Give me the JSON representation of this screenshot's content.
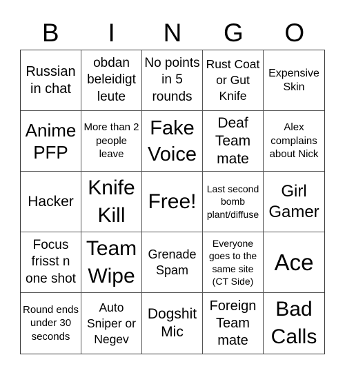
{
  "header": {
    "letters": [
      "B",
      "I",
      "N",
      "G",
      "O"
    ]
  },
  "board": {
    "cells": [
      "Russian in chat",
      "obdan beleidigt leute",
      "No points in 5 rounds",
      "Rust Coat or Gut Knife",
      "Expensive Skin",
      "Anime PFP",
      "More than 2 people leave",
      "Fake Voice",
      "Deaf Team mate",
      "Alex complains about Nick",
      "Hacker",
      "Knife Kill",
      "Free!",
      "Last second bomb plant/diffuse",
      "Girl Gamer",
      "Focus frisst n one shot",
      "Team Wipe",
      "Grenade Spam",
      "Everyone goes to the same site (CT Side)",
      "Ace",
      "Round ends under 30 seconds",
      "Auto Sniper or Negev",
      "Dogshit Mic",
      "Foreign Team mate",
      "Bad Calls"
    ],
    "free_space_index": 12
  }
}
